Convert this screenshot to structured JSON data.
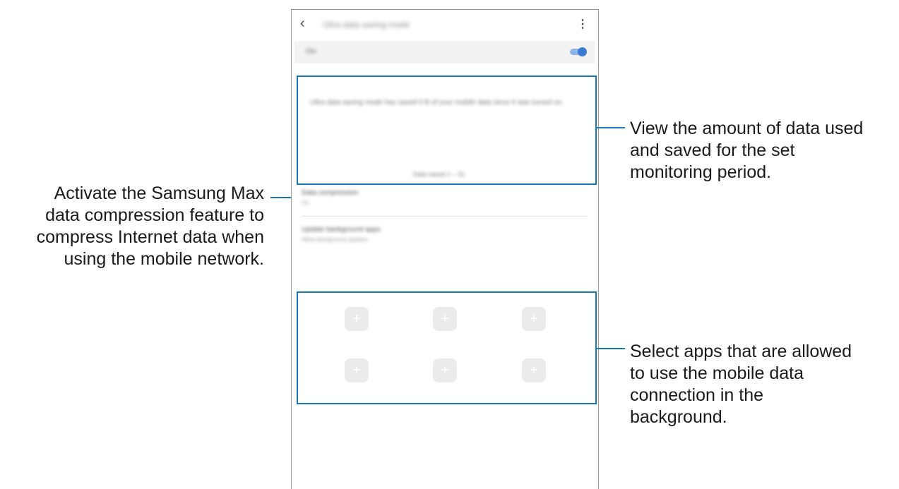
{
  "app_bar": {
    "back_icon": "chevron-left-icon",
    "title": "Ultra data saving mode",
    "more_icon": "more-vertical-icon"
  },
  "master_switch": {
    "label": "On",
    "state": "on",
    "accent_color": "#3a7bd5"
  },
  "summary": {
    "description": "Ultra data saving mode has saved 0 B of your mobile data since it was turned on.",
    "period": "Data saved 1 – 31"
  },
  "settings": [
    {
      "title": "Data compression",
      "subtitle": "On"
    },
    {
      "title": "Update background apps",
      "subtitle": "Allow background updates"
    }
  ],
  "allowed_apps_slots": [
    "+",
    "+",
    "+",
    "+",
    "+",
    "+"
  ],
  "callouts": {
    "left": [
      "Activate the Samsung Max",
      "data compression feature to",
      "compress Internet data when",
      "using the mobile network."
    ],
    "right_top": [
      "View the amount of data used",
      "and saved for the set",
      "monitoring period."
    ],
    "right_bottom": [
      "Select apps that are allowed",
      "to use the mobile data",
      "connection in the",
      "background."
    ]
  },
  "highlight_color": "#1877b8"
}
